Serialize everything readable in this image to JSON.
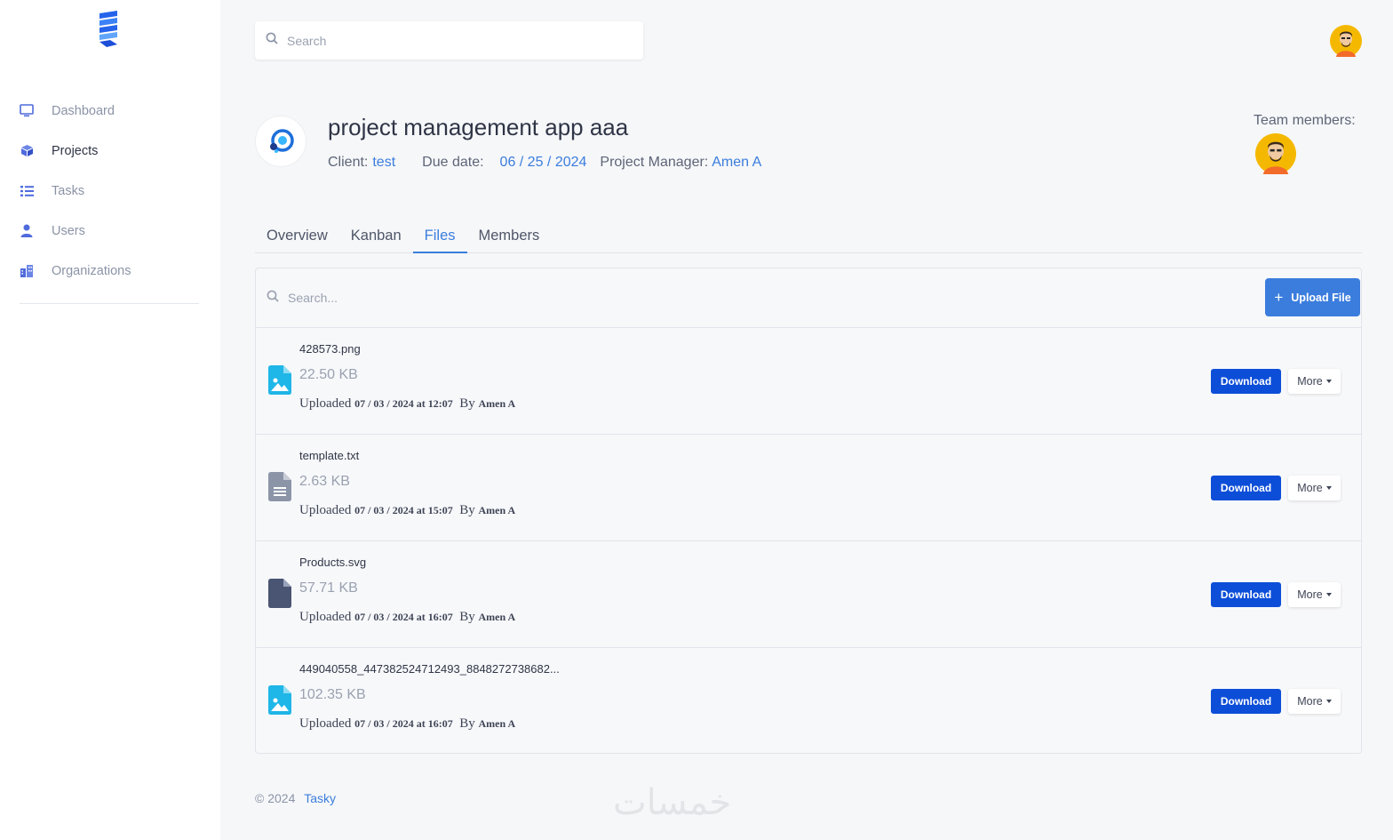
{
  "colors": {
    "accent": "#3b7ddd",
    "download": "#0d4ed8",
    "sidebar_bg": "#ffffff",
    "page_bg": "#f6f7f9"
  },
  "sidebar": {
    "logo_icon": "stacked-layers-logo-icon",
    "items": [
      {
        "label": "Dashboard",
        "icon": "monitor-icon",
        "active": false
      },
      {
        "label": "Projects",
        "icon": "cube-icon",
        "active": true
      },
      {
        "label": "Tasks",
        "icon": "list-icon",
        "active": false
      },
      {
        "label": "Users",
        "icon": "user-icon",
        "active": false
      },
      {
        "label": "Organizations",
        "icon": "building-icon",
        "active": false
      }
    ]
  },
  "header": {
    "search_placeholder": "Search"
  },
  "project": {
    "title": "project management app aaa",
    "client_label": "Client:",
    "client": "test",
    "due_label": "Due date:",
    "due_date": "06 / 25 / 2024",
    "manager_label": "Project Manager:",
    "manager": "Amen A",
    "team_label": "Team members:"
  },
  "tabs": [
    {
      "label": "Overview",
      "active": false
    },
    {
      "label": "Kanban",
      "active": false
    },
    {
      "label": "Files",
      "active": true
    },
    {
      "label": "Members",
      "active": false
    }
  ],
  "files": {
    "search_placeholder": "Search...",
    "upload_label": "Upload File",
    "download_label": "Download",
    "more_label": "More",
    "uploaded_word": "Uploaded",
    "by_word": "By",
    "items": [
      {
        "name": "428573.png",
        "size": "22.50 KB",
        "date": "07 / 03 / 2024 at 12:07",
        "author": "Amen A",
        "icon": "image-file-icon"
      },
      {
        "name": "template.txt",
        "size": "2.63 KB",
        "date": "07 / 03 / 2024 at 15:07",
        "author": "Amen A",
        "icon": "text-file-icon"
      },
      {
        "name": "Products.svg",
        "size": "57.71 KB",
        "date": "07 / 03 / 2024 at 16:07",
        "author": "Amen A",
        "icon": "file-icon"
      },
      {
        "name": "449040558_447382524712493_8848272738682...",
        "size": "102.35 KB",
        "date": "07 / 03 / 2024 at 16:07",
        "author": "Amen A",
        "icon": "image-file-icon"
      }
    ]
  },
  "footer": {
    "copyright": "© 2024",
    "brand": "Tasky"
  },
  "watermark": "خمسات"
}
